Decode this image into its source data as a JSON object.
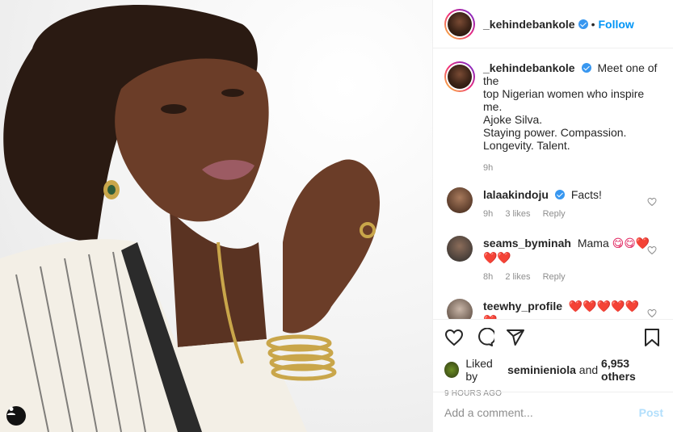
{
  "post": {
    "author": "_kehindebankole",
    "follow_label": "Follow",
    "dot": "•",
    "caption_lines": [
      "Meet one of the",
      "top Nigerian women who inspire me.",
      "Ajoke Silva.",
      "Staying power. Compassion.",
      "Longevity. Talent."
    ],
    "caption_time": "9h"
  },
  "comments": [
    {
      "user": "lalaakindoju",
      "verified": true,
      "text": "Facts!",
      "time": "9h",
      "likes": "3 likes",
      "reply": "Reply"
    },
    {
      "user": "seams_byminah",
      "verified": false,
      "text": "Mama",
      "emoji": "😋😋❤️❤️❤️",
      "time": "8h",
      "likes": "2 likes",
      "reply": "Reply"
    },
    {
      "user": "teewhy_profile",
      "verified": false,
      "text": "❤️❤️❤️❤️❤️❤️"
    }
  ],
  "footer": {
    "liked_by_prefix": "Liked by",
    "liked_by_user": "seminieniola",
    "liked_by_and": "and",
    "liked_by_count": "6,953 others",
    "time_ago": "9 HOURS AGO",
    "add_comment_placeholder": "Add a comment...",
    "post_label": "Post"
  },
  "icons": [
    "user-tag-icon",
    "verified-icon",
    "heart-icon",
    "comment-icon",
    "share-icon",
    "bookmark-icon"
  ],
  "colors": {
    "accent": "#0095f6",
    "muted": "#8e8e8e",
    "heart": "#e0245e",
    "verified": "#3897f0"
  }
}
